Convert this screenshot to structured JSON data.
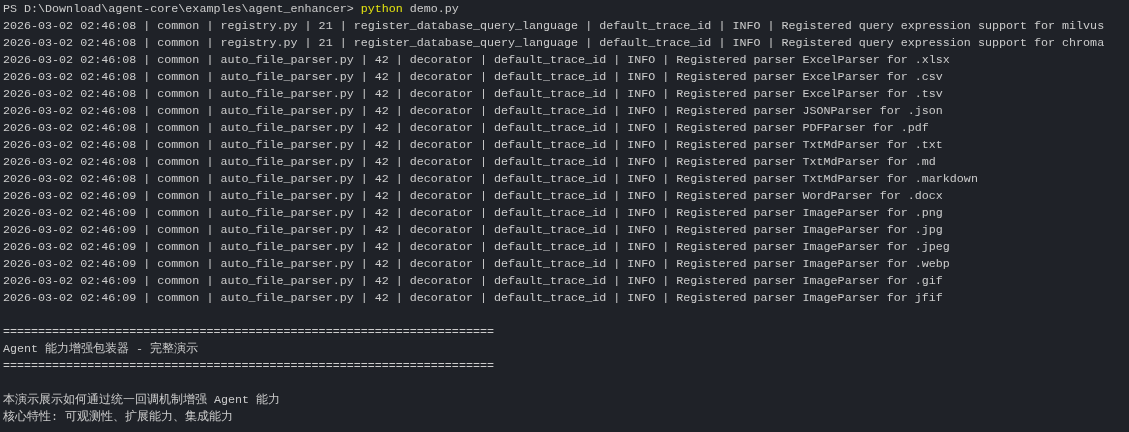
{
  "terminal": {
    "prompt": "PS D:\\Download\\agent-core\\examples\\agent_enhancer>",
    "command": "python",
    "args": "demo.py",
    "log_lines": [
      "2026-03-02 02:46:08 | common | registry.py | 21 | register_database_query_language | default_trace_id | INFO | Registered query expression support for milvus",
      "2026-03-02 02:46:08 | common | registry.py | 21 | register_database_query_language | default_trace_id | INFO | Registered query expression support for chroma",
      "2026-03-02 02:46:08 | common | auto_file_parser.py | 42 | decorator | default_trace_id | INFO | Registered parser ExcelParser for .xlsx",
      "2026-03-02 02:46:08 | common | auto_file_parser.py | 42 | decorator | default_trace_id | INFO | Registered parser ExcelParser for .csv",
      "2026-03-02 02:46:08 | common | auto_file_parser.py | 42 | decorator | default_trace_id | INFO | Registered parser ExcelParser for .tsv",
      "2026-03-02 02:46:08 | common | auto_file_parser.py | 42 | decorator | default_trace_id | INFO | Registered parser JSONParser for .json",
      "2026-03-02 02:46:08 | common | auto_file_parser.py | 42 | decorator | default_trace_id | INFO | Registered parser PDFParser for .pdf",
      "2026-03-02 02:46:08 | common | auto_file_parser.py | 42 | decorator | default_trace_id | INFO | Registered parser TxtMdParser for .txt",
      "2026-03-02 02:46:08 | common | auto_file_parser.py | 42 | decorator | default_trace_id | INFO | Registered parser TxtMdParser for .md",
      "2026-03-02 02:46:08 | common | auto_file_parser.py | 42 | decorator | default_trace_id | INFO | Registered parser TxtMdParser for .markdown",
      "2026-03-02 02:46:09 | common | auto_file_parser.py | 42 | decorator | default_trace_id | INFO | Registered parser WordParser for .docx",
      "2026-03-02 02:46:09 | common | auto_file_parser.py | 42 | decorator | default_trace_id | INFO | Registered parser ImageParser for .png",
      "2026-03-02 02:46:09 | common | auto_file_parser.py | 42 | decorator | default_trace_id | INFO | Registered parser ImageParser for .jpg",
      "2026-03-02 02:46:09 | common | auto_file_parser.py | 42 | decorator | default_trace_id | INFO | Registered parser ImageParser for .jpeg",
      "2026-03-02 02:46:09 | common | auto_file_parser.py | 42 | decorator | default_trace_id | INFO | Registered parser ImageParser for .webp",
      "2026-03-02 02:46:09 | common | auto_file_parser.py | 42 | decorator | default_trace_id | INFO | Registered parser ImageParser for .gif",
      "2026-03-02 02:46:09 | common | auto_file_parser.py | 42 | decorator | default_trace_id | INFO | Registered parser ImageParser for jfif"
    ],
    "banner": {
      "rule_top": "======================================================================",
      "title": "Agent 能力增强包装器 - 完整演示",
      "rule_bottom": "======================================================================"
    },
    "intro_lines": [
      "本演示展示如何通过统一回调机制增强 Agent 能力",
      "核心特性: 可观测性、扩展能力、集成能力"
    ]
  }
}
